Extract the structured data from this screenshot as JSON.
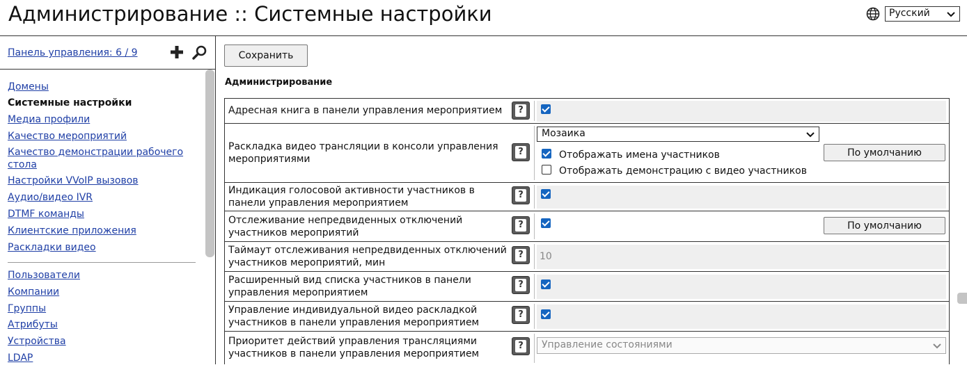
{
  "header": {
    "title": "Администрирование :: Системные настройки",
    "language": "Русский",
    "globe_icon": "globe-icon"
  },
  "sidebar": {
    "dashboard_link": "Панель управления: 6 / 9",
    "add_icon": "plus-icon",
    "search_icon": "magnifier-icon",
    "items": [
      {
        "label": "Домены"
      },
      {
        "label": "Системные настройки",
        "active": true
      },
      {
        "label": "Медиа профили"
      },
      {
        "label": "Качество мероприятий"
      },
      {
        "label": "Качество демонстрации рабочего стола"
      },
      {
        "label": "Настройки VVoIP вызовов"
      },
      {
        "label": "Аудио/видео IVR"
      },
      {
        "label": "DTMF команды"
      },
      {
        "label": "Клиентские приложения"
      },
      {
        "label": "Раскладки видео"
      }
    ],
    "items2": [
      {
        "label": "Пользователи"
      },
      {
        "label": "Компании"
      },
      {
        "label": "Группы"
      },
      {
        "label": "Атрибуты"
      },
      {
        "label": "Устройства"
      },
      {
        "label": "LDAP"
      }
    ]
  },
  "main": {
    "save_label": "Сохранить",
    "section_title": "Администрирование",
    "help_label": "?",
    "rows": [
      {
        "label": "Адресная книга в панели управления мероприятием",
        "checked": true
      },
      {
        "label": "Раскладка видео трансляции в консоли управления мероприятиями",
        "select_value": "Мозаика",
        "options": [
          {
            "label": "Отображать имена участников",
            "checked": true
          },
          {
            "label": "Отображать демонстрацию с видео участников",
            "checked": false
          }
        ],
        "default_label": "По умолчанию"
      },
      {
        "label": "Индикация голосовой активности участников в панели управления мероприятием",
        "checked": true
      },
      {
        "label": "Отслеживание непредвиденных отключений участников мероприятий",
        "checked": true,
        "default_label": "По умолчанию"
      },
      {
        "label": "Таймаут отслеживания непредвиденных отключений участников мероприятий, мин",
        "value": "10"
      },
      {
        "label": "Расширенный вид списка участников в панели управления мероприятием",
        "checked": true
      },
      {
        "label": "Управление индивидуальной видео раскладкой участников в панели управления мероприятием",
        "checked": true
      },
      {
        "label": "Приоритет действий управления трансляциями участников в панели управления мероприятием",
        "select_value": "Управление состояниями"
      }
    ]
  }
}
